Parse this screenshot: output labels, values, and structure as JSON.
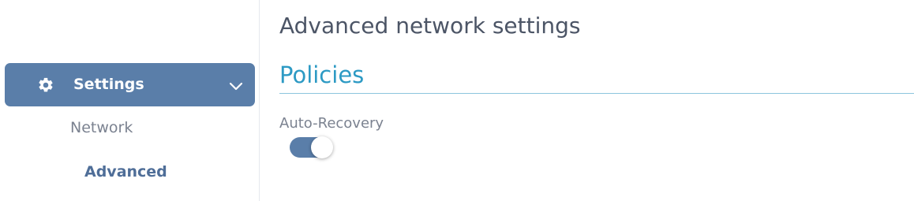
{
  "sidebar": {
    "header": {
      "label": "Settings",
      "icon": "gear-icon",
      "expand_icon": "chevron-down-icon"
    },
    "items": [
      {
        "label": "Network",
        "active": false
      },
      {
        "label": "Advanced",
        "active": true
      }
    ]
  },
  "main": {
    "title": "Advanced network settings",
    "section": {
      "title": "Policies",
      "settings": [
        {
          "label": "Auto-Recovery",
          "type": "toggle",
          "enabled": true
        }
      ]
    }
  },
  "colors": {
    "accent": "#5a7ea9",
    "section_title": "#2d9ac4",
    "active_nav": "#4f6e98"
  }
}
